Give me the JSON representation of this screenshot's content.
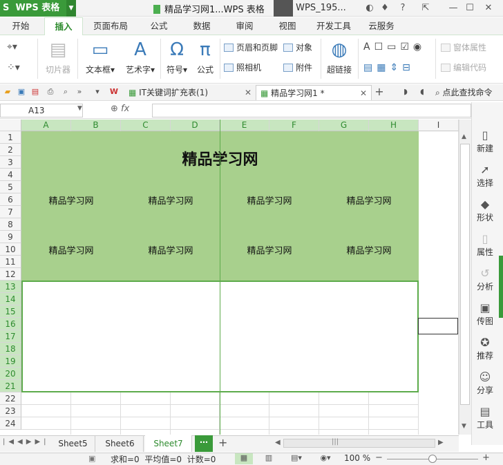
{
  "app": {
    "name": "WPS 表格",
    "doc_title": "精品学习网1...WPS 表格",
    "account": "WPS_195..."
  },
  "ribbon_tabs": [
    "开始",
    "插入",
    "页面布局",
    "公式",
    "数据",
    "审阅",
    "视图",
    "开发工具",
    "云服务"
  ],
  "active_tab": "插入",
  "ribbon": {
    "slicer": "切片器",
    "textbox": "文本框",
    "wordart": "艺术字",
    "symbol": "符号",
    "formula": "公式",
    "header_footer": "页眉和页脚",
    "object": "对象",
    "camera": "照相机",
    "attachment": "附件",
    "hyperlink": "超链接",
    "form_props": "窗体属性",
    "edit_code": "编辑代码"
  },
  "doc_tabs": [
    {
      "label": "IT关键词扩充表(1)",
      "active": false
    },
    {
      "label": "精品学习网1 *",
      "active": true
    }
  ],
  "search_cmd": "点此查找命令",
  "name_box": "A13",
  "fx_label": "fx",
  "columns": [
    "A",
    "B",
    "C",
    "D",
    "E",
    "F",
    "G",
    "H",
    "I"
  ],
  "rows": [
    "1",
    "2",
    "3",
    "4",
    "5",
    "6",
    "7",
    "8",
    "9",
    "10",
    "11",
    "12",
    "13",
    "14",
    "15",
    "16",
    "17",
    "18",
    "19",
    "20",
    "21",
    "22",
    "23",
    "24"
  ],
  "sheet_title": "精品学习网",
  "cell_text": "精品学习网",
  "side_panel": [
    "新建",
    "选择",
    "形状",
    "属性",
    "分析",
    "传图",
    "推荐",
    "分享",
    "工具"
  ],
  "sheets": [
    "Sheet5",
    "Sheet6",
    "Sheet7"
  ],
  "active_sheet": "Sheet7",
  "status": {
    "sum": "求和=0",
    "avg": "平均值=0",
    "count": "计数=0",
    "zoom": "100 %"
  },
  "colors": {
    "accent": "#3a9a3a",
    "fill": "#a8d08d",
    "border": "#5cab4a"
  }
}
